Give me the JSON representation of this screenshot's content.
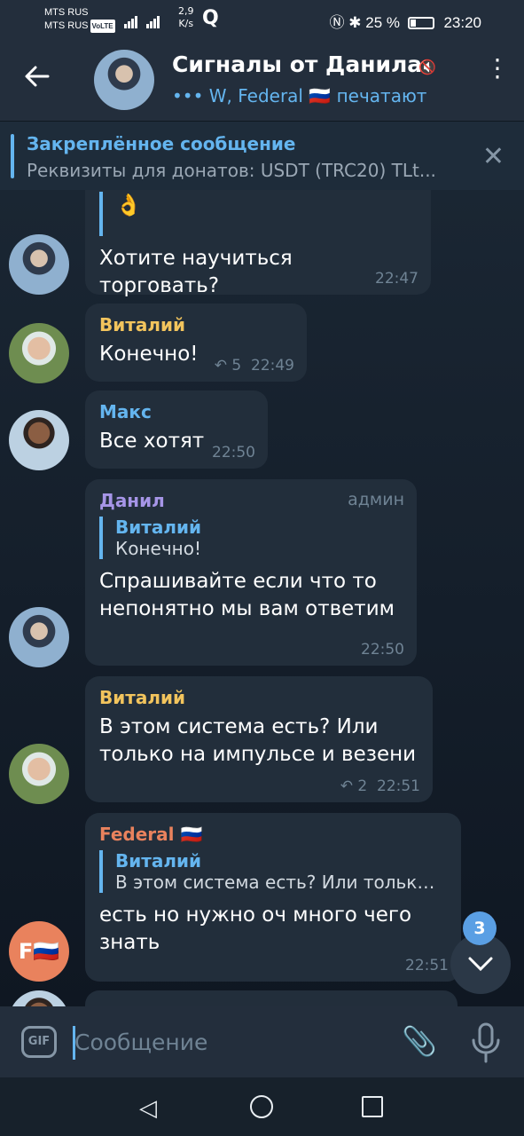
{
  "status_bar": {
    "carrier_1": "MTS RUS",
    "carrier_2": "MTS RUS",
    "volte": "VoLTE",
    "network_speed": "2,9",
    "network_speed_unit": "K/s",
    "battery": "25 %",
    "time": "23:20"
  },
  "header": {
    "title": "Сигналы от Данила",
    "subtitle": "W, Federal 🇷🇺 печатают"
  },
  "pinned": {
    "title": "Закреплённое сообщение",
    "text": "Реквизиты для донатов:  USDT (TRC20)  TLt..."
  },
  "messages": [
    {
      "text_emoji": "👌",
      "text": "Хотите научиться торговать?",
      "time": "22:47"
    },
    {
      "sender": "Виталий",
      "text": "Конечно!",
      "replies": "5",
      "time": "22:49"
    },
    {
      "sender": "Макс",
      "text": "Все хотят",
      "time": "22:50"
    },
    {
      "sender": "Данил",
      "badge": "админ",
      "reply_name": "Виталий",
      "reply_text": "Конечно!",
      "text": "Спрашивайте если что то непонятно мы вам ответим",
      "time": "22:50"
    },
    {
      "sender": "Виталий",
      "text": "В этом система есть? Или только на импульсе и везени",
      "replies": "2",
      "time": "22:51"
    },
    {
      "sender": "Federal 🇷🇺",
      "reply_name": "Виталий",
      "reply_text": "В этом система есть? Или только…",
      "text": "есть но нужно оч много чего знать",
      "time": "22:51",
      "avatar_initials": "F🇷🇺"
    }
  ],
  "scroll_badge": "3",
  "composer": {
    "gif_label": "GIF",
    "placeholder": "Сообщение"
  }
}
